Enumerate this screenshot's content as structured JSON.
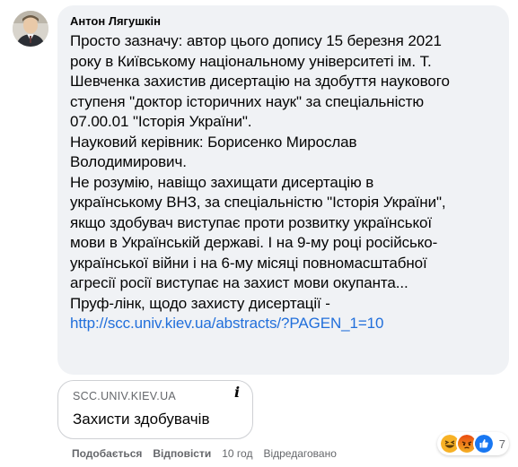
{
  "comment": {
    "author": "Антон Лягушкін",
    "lines": [
      "Просто зазначу: автор цього допису 15 березня 2021",
      "року в Київському національному університеті ім. Т.",
      "Шевченка захистив дисертацію на здобуття наукового",
      "ступеня \"доктор історичних наук\" за спеціальністю",
      "07.00.01 \"Історія України\".",
      "Науковий керівник: Борисенко Мирослав",
      "Володимирович.",
      "Не розумію, навіщо захищати дисертацію в",
      "українському ВНЗ, за спеціальністю \"Історія України\",",
      "якщо здобувач виступає проти розвитку української",
      "мови в Українській державі. І на 9-му році російсько-",
      "української війни і на 6-му місяці повномасштабної",
      "агресії росії виступає на захист мови окупанта...",
      "Пруф-лінк, щодо захисту дисертації -"
    ],
    "link_text": "http://scc.univ.kiev.ua/abstracts/?PAGEN_1=10"
  },
  "link_preview": {
    "domain": "SCC.UNIV.KIEV.UA",
    "title": "Захисти здобувачів",
    "info_icon": "info-icon"
  },
  "actions": {
    "like_label": "Подобається",
    "reply_label": "Відповісти",
    "time": "10 год",
    "edited": "Відредаговано"
  },
  "reactions": {
    "types": [
      "haha",
      "angry",
      "like"
    ],
    "count": "7",
    "colors": {
      "haha": "#f7b125",
      "angry": "#e9710f",
      "like": "#1877f2"
    }
  },
  "colors": {
    "link": "#216fdb",
    "bubble": "#f0f2f5",
    "muted": "#65676b",
    "text": "#050505"
  }
}
